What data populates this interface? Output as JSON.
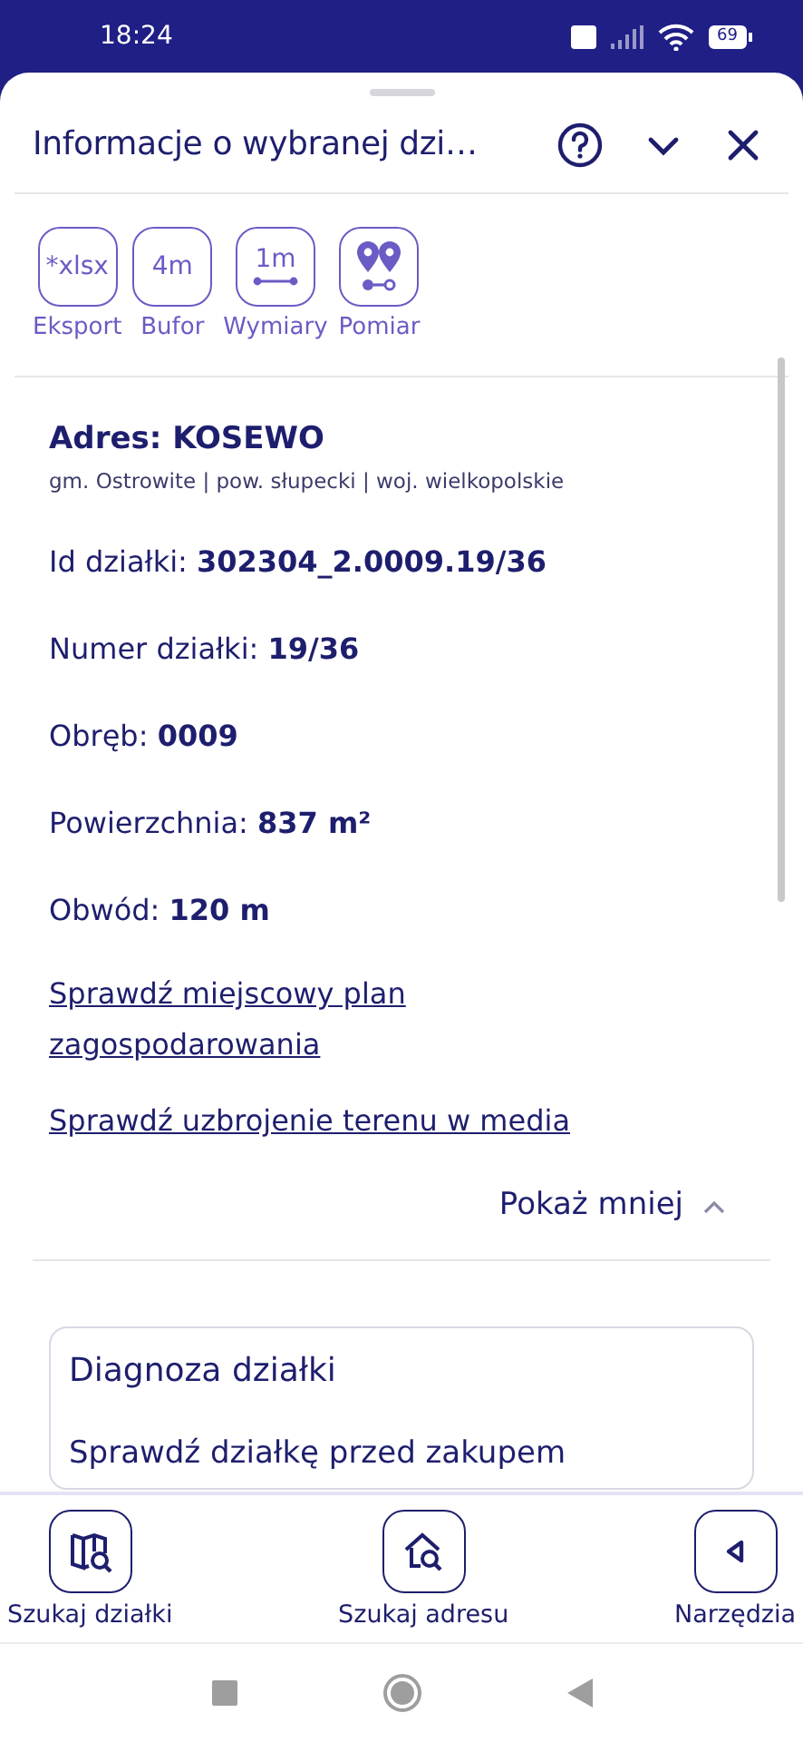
{
  "status_bar": {
    "time": "18:24",
    "battery": "69"
  },
  "sheet": {
    "title": "Informacje o wybranej dzi…"
  },
  "tools": [
    {
      "kind": "text",
      "glyph": "*xlsx",
      "label": "Eksport"
    },
    {
      "kind": "text",
      "glyph": "4m",
      "label": "Bufor"
    },
    {
      "kind": "ruler",
      "glyph": "1m",
      "label": "Wymiary"
    },
    {
      "kind": "pins",
      "label": "Pomiar"
    }
  ],
  "address": {
    "title": "Adres: KOSEWO",
    "subtitle": "gm. Ostrowite | pow. słupecki | woj. wielkopolskie"
  },
  "fields": [
    {
      "label": "Id działki:",
      "value": "302304_2.0009.19/36"
    },
    {
      "label": "Numer działki:",
      "value": "19/36"
    },
    {
      "label": "Obręb:",
      "value": "0009"
    },
    {
      "label": "Powierzchnia:",
      "value": "837 m²"
    },
    {
      "label": "Obwód:",
      "value": "120 m"
    }
  ],
  "links": [
    "Sprawdź miejscowy plan zagospodarowania",
    "Sprawdź uzbrojenie terenu w media"
  ],
  "toggle": {
    "label": "Pokaż mniej",
    "expanded": true
  },
  "diagnosis": {
    "title": "Diagnoza działki",
    "text": "Sprawdź działkę przed zakupem"
  },
  "bottom_nav": [
    {
      "kind": "map",
      "label": "Szukaj działki"
    },
    {
      "kind": "house",
      "label": "Szukaj adresu"
    },
    {
      "kind": "back",
      "label": "Narzędzia"
    }
  ]
}
